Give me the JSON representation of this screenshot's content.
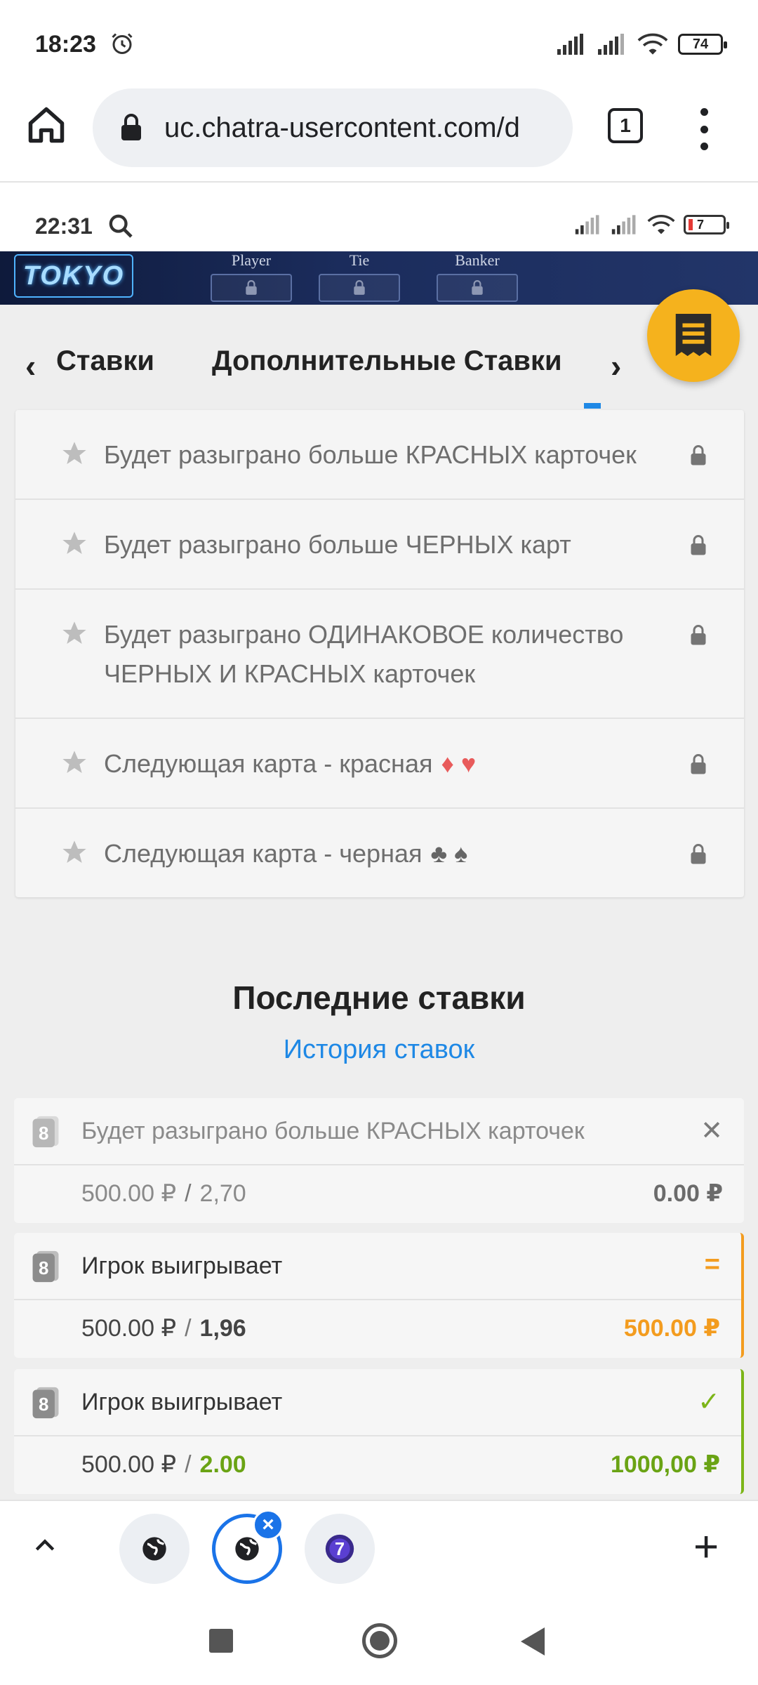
{
  "status_bar": {
    "time": "18:23",
    "battery": "74"
  },
  "browser": {
    "url": "uc.chatra-usercontent.com/d",
    "tab_count": "1"
  },
  "inner_status": {
    "time": "22:31",
    "battery": "7"
  },
  "game_banner": {
    "logo": "TOKYO",
    "columns": [
      "Player",
      "Tie",
      "Banker"
    ]
  },
  "tabs": {
    "left_label": "Ставки",
    "active_label": "Дополнительные Ставки"
  },
  "bets": [
    {
      "label": "Будет разыграно больше КРАСНЫХ карточек"
    },
    {
      "label": "Будет разыграно больше ЧЕРНЫХ карт"
    },
    {
      "label": "Будет разыграно ОДИНАКОВОЕ количество ЧЕРНЫХ И КРАСНЫХ карточек"
    },
    {
      "label": "Следующая карта - красная",
      "suits": "♦ ♥"
    },
    {
      "label": "Следующая карта - черная",
      "suits": "♣ ♠"
    }
  ],
  "recent": {
    "title": "Последние ставки",
    "history_link": "История ставок",
    "items": [
      {
        "name": "Будет разыграно больше КРАСНЫХ карточек",
        "stake": "500.00 ₽",
        "separator": "/",
        "odds": "2,70",
        "payout": "0.00 ₽",
        "status_symbol": "✕"
      },
      {
        "name": "Игрок выигрывает",
        "stake": "500.00 ₽",
        "separator": "/",
        "odds": "1,96",
        "payout": "500.00 ₽",
        "status_symbol": "="
      },
      {
        "name": "Игрок выигрывает",
        "stake": "500.00 ₽",
        "separator": "/",
        "odds": "2.00",
        "payout": "1000,00 ₽",
        "status_symbol": "✓"
      }
    ]
  },
  "colors": {
    "accent_blue": "#1e88e5",
    "fab_yellow": "#f5b21d",
    "orange": "#f39c1f",
    "green": "#6aa314"
  },
  "bottom_tabs": {
    "plus": "+"
  }
}
